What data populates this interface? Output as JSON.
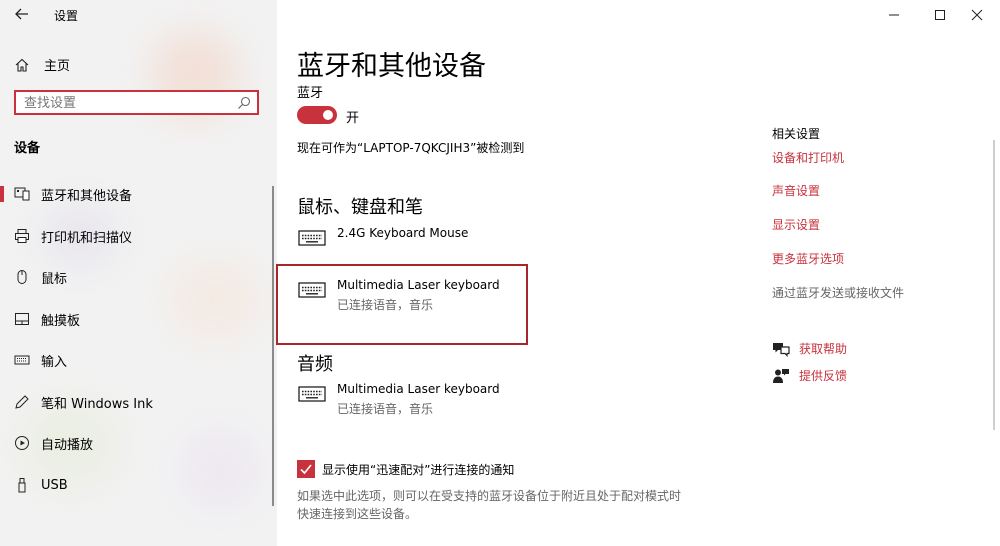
{
  "window": {
    "title": "设置",
    "controls": [
      "minimize-icon",
      "maximize-icon",
      "close-icon"
    ]
  },
  "sidebar": {
    "home_label": "主页",
    "search_placeholder": "查找设置",
    "section_title": "设备",
    "items": [
      {
        "label": "蓝牙和其他设备",
        "icon": "bluetooth-devices-icon",
        "active": true
      },
      {
        "label": "打印机和扫描仪",
        "icon": "printer-icon",
        "active": false
      },
      {
        "label": "鼠标",
        "icon": "mouse-icon",
        "active": false
      },
      {
        "label": "触摸板",
        "icon": "touchpad-icon",
        "active": false
      },
      {
        "label": "输入",
        "icon": "keyboard-icon",
        "active": false
      },
      {
        "label": "笔和 Windows Ink",
        "icon": "pen-icon",
        "active": false
      },
      {
        "label": "自动播放",
        "icon": "autoplay-icon",
        "active": false
      },
      {
        "label": "USB",
        "icon": "usb-icon",
        "active": false
      }
    ]
  },
  "main": {
    "title": "蓝牙和其他设备",
    "bluetooth_label": "蓝牙",
    "toggle_state": "开",
    "discoverable_text": "现在可作为“LAPTOP-7QKCJIH3”被检测到",
    "sections": {
      "input": {
        "heading": "鼠标、键盘和笔",
        "devices": [
          {
            "name": "2.4G Keyboard Mouse",
            "status": ""
          },
          {
            "name": "Multimedia Laser keyboard",
            "status": "已连接语音，音乐"
          }
        ]
      },
      "audio": {
        "heading": "音频",
        "devices": [
          {
            "name": "Multimedia Laser keyboard",
            "status": "已连接语音，音乐"
          }
        ]
      }
    },
    "swift_pair": {
      "checked": true,
      "label": "显示使用“迅速配对”进行连接的通知",
      "help_line1": "如果选中此选项，则可以在受支持的蓝牙设备位于附近且处于配对模式时",
      "help_line2": "快速连接到这些设备。"
    }
  },
  "related": {
    "title": "相关设置",
    "links": [
      "设备和打印机",
      "声音设置",
      "显示设置",
      "更多蓝牙选项"
    ],
    "send_receive": "通过蓝牙发送或接收文件",
    "get_help": "获取帮助",
    "feedback": "提供反馈"
  },
  "colors": {
    "accent": "#c8323c",
    "highlight_border": "#a6262c",
    "sidebar_bg": "#f2f2f2"
  }
}
